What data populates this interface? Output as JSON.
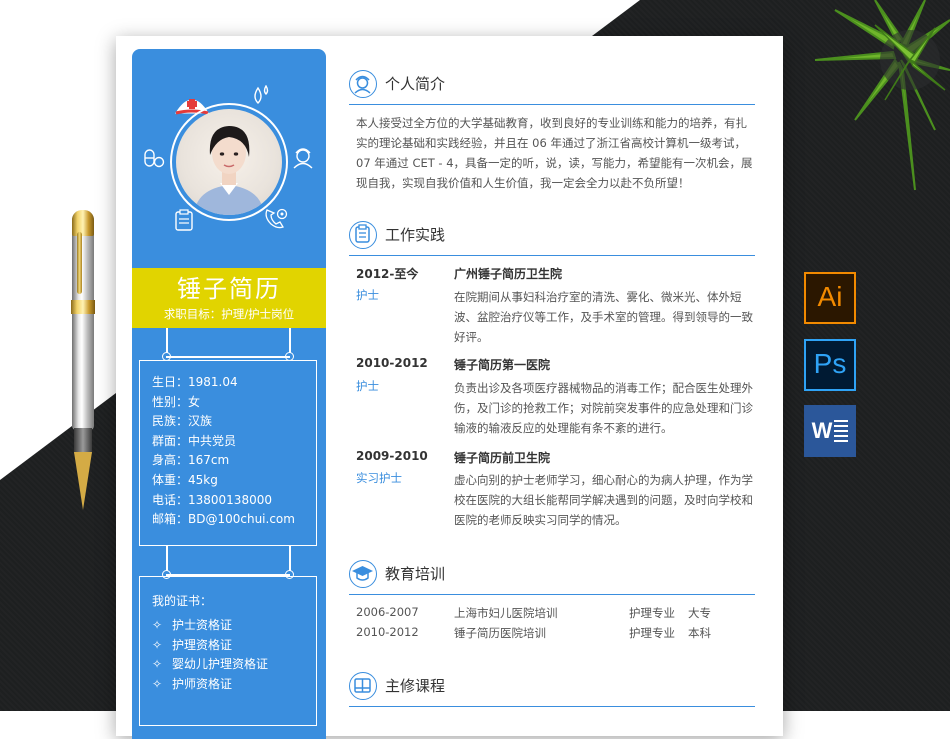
{
  "sidebar": {
    "name": "锤子简历",
    "goal": "求职目标：护理/护士岗位",
    "info": [
      "生日：1981.04",
      "性别：女",
      "民族：汉族",
      "群面：中共党员",
      "身高：167cm",
      "体重：45kg",
      "电话：13800138000",
      "邮箱：BD@100chui.com"
    ],
    "cert_title": "我的证书：",
    "cert_marker": "✧",
    "certs": [
      "护士资格证",
      "护理资格证",
      "婴幼儿护理资格证",
      "护师资格证"
    ]
  },
  "profile": {
    "title": "个人简介",
    "text": "本人接受过全方位的大学基础教育，收到良好的专业训练和能力的培养，有扎实的理论基础和实践经验，并且在 06 年通过了浙江省高校计算机一级考试，07 年通过 CET - 4，具备一定的听，说，读，写能力，希望能有一次机会，展现自我，实现自我价值和人生价值，我一定会全力以赴不负所望！"
  },
  "work": {
    "title": "工作实践",
    "jobs": [
      {
        "date": "2012-至今",
        "role": "护士",
        "org": "广州锤子简历卫生院",
        "desc": "在院期间从事妇科治疗室的清洗、雾化、微米光、体外短波、盆腔治疗仪等工作，及手术室的管理。得到领导的一致好评。"
      },
      {
        "date": "2010-2012",
        "role": "护士",
        "org": "锤子简历第一医院",
        "desc": "负责出诊及各项医疗器械物品的消毒工作；配合医生处理外伤，及门诊的抢救工作；对院前突发事件的应急处理和门诊输液的输液反应的处理能有条不紊的进行。"
      },
      {
        "date": "2009-2010",
        "role": "实习护士",
        "org": "锤子简历前卫生院",
        "desc": "虚心向别的护士老师学习，细心耐心的为病人护理，作为学校在医院的大组长能帮同学解决遇到的问题，及时向学校和医院的老师反映实习同学的情况。"
      }
    ]
  },
  "education": {
    "title": "教育培训",
    "rows": [
      {
        "date": "2006-2007",
        "school": "上海市妇儿医院培训",
        "major": "护理专业",
        "degree": "大专"
      },
      {
        "date": "2010-2012",
        "school": "锤子简历医院培训",
        "major": "护理专业",
        "degree": "本科"
      }
    ]
  },
  "courses": {
    "title": "主修课程"
  },
  "apps": {
    "ai": "Ai",
    "ps": "Ps",
    "word": "W"
  },
  "colors": {
    "accent": "#3a8ede",
    "name_band": "#e1d400",
    "dark_bg": "#1e2021"
  }
}
